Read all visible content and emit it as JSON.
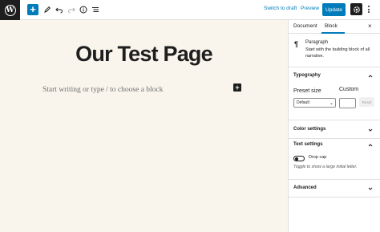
{
  "toolbar": {
    "logo_icon": "wordpress-logo-icon",
    "add_icon": "+",
    "tools": [
      "pencil-icon",
      "undo-icon",
      "redo-icon",
      "info-icon",
      "list-view-icon"
    ],
    "switch_to_draft": "Switch to draft",
    "preview": "Preview",
    "update": "Update",
    "settings_icon": "gear-icon",
    "more_icon": "more-vertical-icon",
    "accent_color": "#007cba"
  },
  "editor": {
    "title": "Our Test Page",
    "placeholder": "Start writing or type / to choose a block",
    "inline_add_icon": "+",
    "background": "#f9f5ec"
  },
  "sidebar": {
    "tabs": [
      "Document",
      "Block"
    ],
    "active_tab": "Block",
    "close_icon": "×",
    "block": {
      "icon": "¶",
      "name": "Paragraph",
      "description": "Start with the building block of all narrative."
    },
    "typography": {
      "title": "Typography",
      "preset_label": "Preset size",
      "custom_label": "Custom",
      "preset_value": "Default",
      "custom_value": "",
      "reset_label": "Reset"
    },
    "color_settings": {
      "title": "Color settings"
    },
    "text_settings": {
      "title": "Text settings",
      "drop_cap_label": "Drop cap",
      "drop_cap_on": false,
      "help": "Toggle to show a large initial letter."
    },
    "advanced": {
      "title": "Advanced"
    }
  }
}
